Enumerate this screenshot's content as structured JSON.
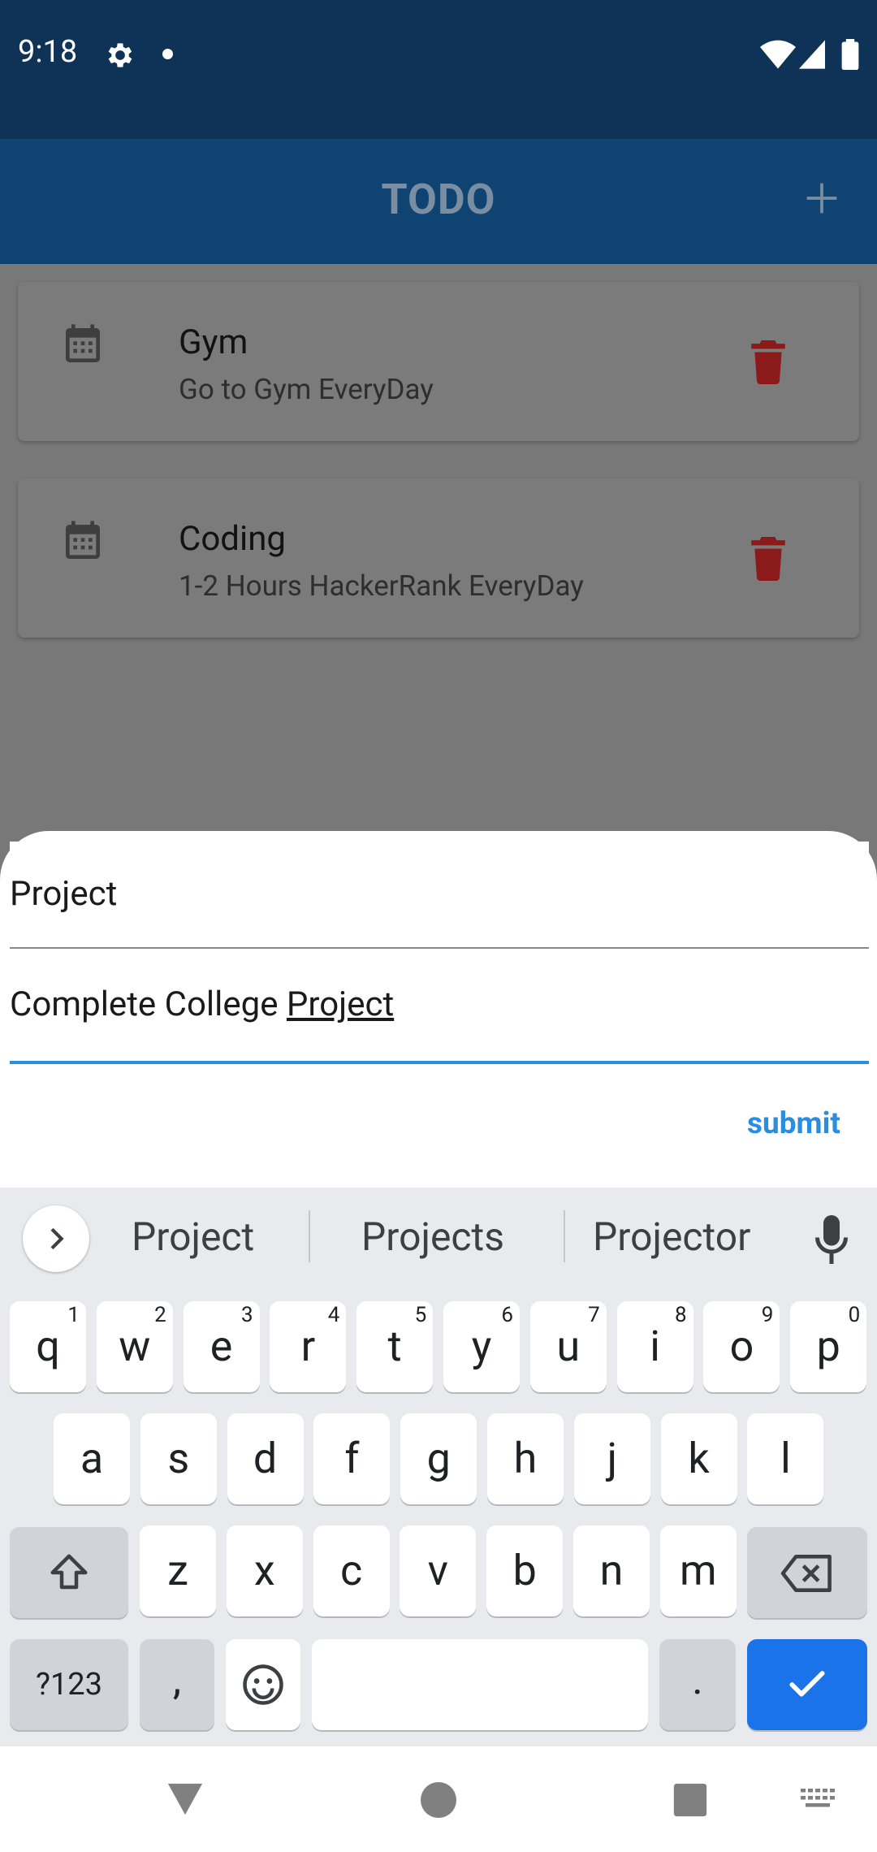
{
  "status_bar": {
    "time": "9:18"
  },
  "app_bar": {
    "title": "TODO"
  },
  "todos": [
    {
      "title": "Gym",
      "description": "Go to Gym EveryDay"
    },
    {
      "title": "Coding",
      "description": "1-2 Hours HackerRank EveryDay"
    }
  ],
  "form": {
    "title_value": "Project",
    "description_prefix": "Complete College ",
    "description_underlined": "Project",
    "submit_label": "submit"
  },
  "keyboard": {
    "suggestions": [
      "Project",
      "Projects",
      "Projector"
    ],
    "row1": [
      {
        "k": "q",
        "h": "1"
      },
      {
        "k": "w",
        "h": "2"
      },
      {
        "k": "e",
        "h": "3"
      },
      {
        "k": "r",
        "h": "4"
      },
      {
        "k": "t",
        "h": "5"
      },
      {
        "k": "y",
        "h": "6"
      },
      {
        "k": "u",
        "h": "7"
      },
      {
        "k": "i",
        "h": "8"
      },
      {
        "k": "o",
        "h": "9"
      },
      {
        "k": "p",
        "h": "0"
      }
    ],
    "row2": [
      "a",
      "s",
      "d",
      "f",
      "g",
      "h",
      "j",
      "k",
      "l"
    ],
    "row3": [
      "z",
      "x",
      "c",
      "v",
      "b",
      "n",
      "m"
    ],
    "symbols_label": "?123",
    "comma_label": ",",
    "period_label": "."
  },
  "colors": {
    "accent": "#2a8ee0",
    "app_bar": "#0f4372",
    "status_bar": "#0f3356",
    "delete": "#8b1a1a",
    "enter_key": "#1a73e8"
  }
}
